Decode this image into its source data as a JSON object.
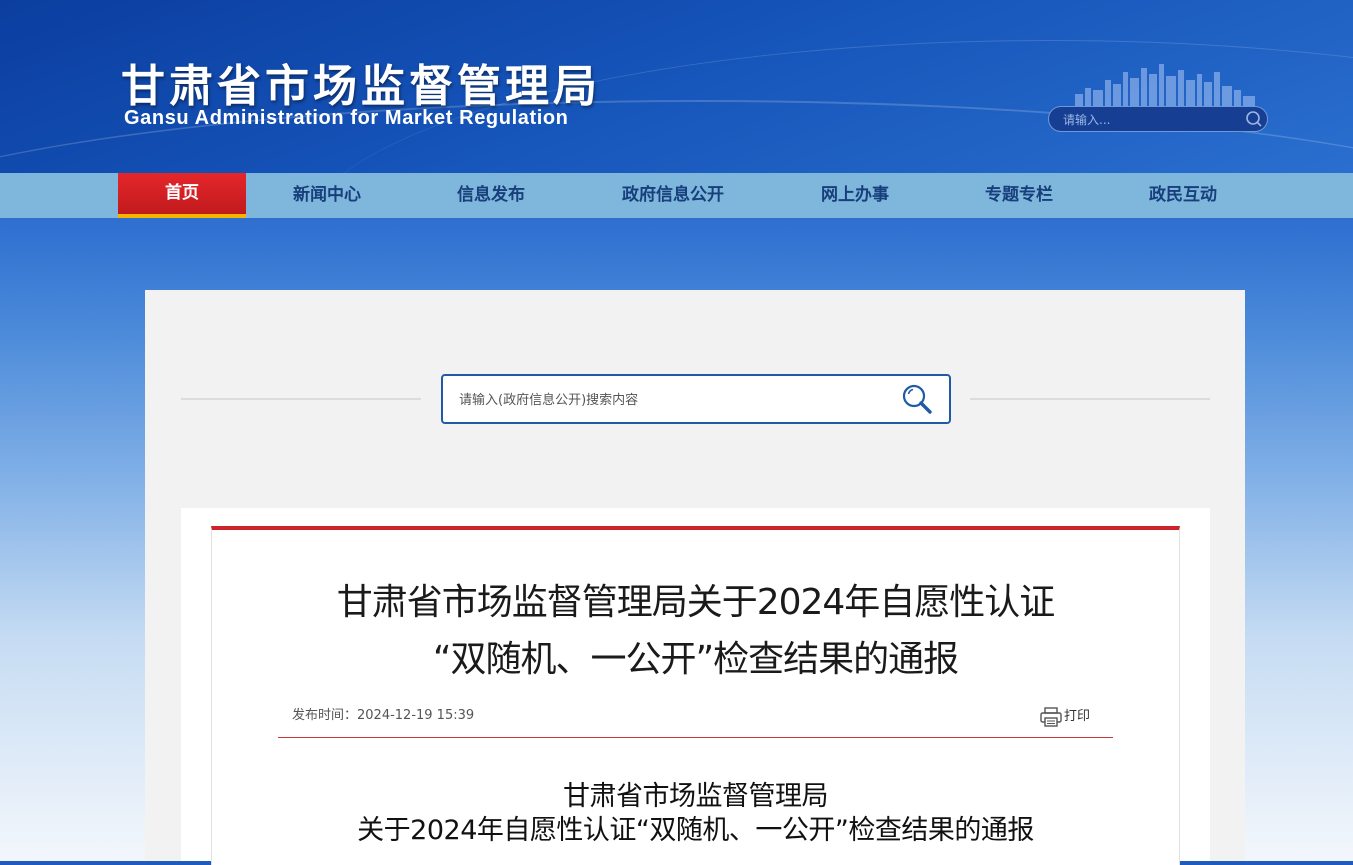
{
  "site": {
    "title_cn": "甘肃省市场监督管理局",
    "title_en": "Gansu Administration for Market Regulation"
  },
  "top_search": {
    "placeholder": "请输入...",
    "icon": "search-icon"
  },
  "nav": {
    "items": [
      {
        "label": "首页",
        "active": true
      },
      {
        "label": "新闻中心"
      },
      {
        "label": "信息发布"
      },
      {
        "label": "政府信息公开"
      },
      {
        "label": "网上办事"
      },
      {
        "label": "专题专栏"
      },
      {
        "label": "政民互动"
      }
    ]
  },
  "gov_search": {
    "placeholder": "请输入(政府信息公开)搜索内容",
    "icon": "magnifier-icon"
  },
  "article": {
    "title_line1": "甘肃省市场监督管理局关于2024年自愿性认证",
    "title_line2": "“双随机、一公开”检查结果的通报",
    "publish_time": "发布时间：2024-12-19 15:39",
    "print_label": "打印",
    "body_heading_line1": "甘肃省市场监督管理局",
    "body_heading_line2": "关于2024年自愿性认证“双随机、一公开”检查结果的通报"
  },
  "colors": {
    "header_blue": "#1553b8",
    "nav_bg": "#7fb6db",
    "nav_active": "#e4272a",
    "nav_active_underline": "#f6b400",
    "article_top_border": "#cc2229",
    "search_border": "#1f5aa6"
  }
}
